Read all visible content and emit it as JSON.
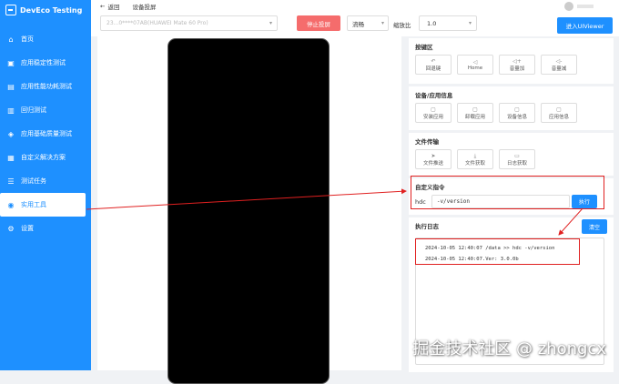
{
  "app": {
    "title": "DevEco Testing"
  },
  "sidebar": {
    "items": [
      {
        "label": "首页",
        "icon": "home-icon",
        "glyph": "⌂"
      },
      {
        "label": "应用稳定性测试",
        "icon": "stability-icon",
        "glyph": "▣"
      },
      {
        "label": "应用性能功耗测试",
        "icon": "performance-icon",
        "glyph": "▤"
      },
      {
        "label": "回归测试",
        "icon": "regression-icon",
        "glyph": "▥"
      },
      {
        "label": "应用基础质量测试",
        "icon": "quality-icon",
        "glyph": "◈"
      },
      {
        "label": "自定义解决方案",
        "icon": "solution-icon",
        "glyph": "▦"
      },
      {
        "label": "测试任务",
        "icon": "task-icon",
        "glyph": "☰"
      },
      {
        "label": "实用工具",
        "icon": "tools-icon",
        "glyph": "◉"
      },
      {
        "label": "设置",
        "icon": "settings-icon",
        "glyph": "⚙"
      }
    ]
  },
  "topbar": {
    "back_label": "返回",
    "breadcrumb": "设备投屏"
  },
  "controls": {
    "device": "23...0****07AB(HUAWEI Mate 60 Pro)",
    "stop_label": "停止投屏",
    "fluency": "流畅",
    "scale_label": "缩放比",
    "scale_value": "1.0",
    "uiviewer_label": "进入UIViewer"
  },
  "keys_card": {
    "title": "按键区",
    "buttons": [
      {
        "label": "回退键",
        "glyph": "↶"
      },
      {
        "label": "Home",
        "glyph": "◁"
      },
      {
        "label": "音量加",
        "glyph": "◁+"
      },
      {
        "label": "音量减",
        "glyph": "◁-"
      }
    ]
  },
  "device_card": {
    "title": "设备/应用信息",
    "buttons": [
      {
        "label": "安装应用",
        "glyph": "▢"
      },
      {
        "label": "卸载应用",
        "glyph": "▢"
      },
      {
        "label": "设备信息",
        "glyph": "▢"
      },
      {
        "label": "应用信息",
        "glyph": "▢"
      }
    ]
  },
  "file_card": {
    "title": "文件传输",
    "buttons": [
      {
        "label": "文件推送",
        "glyph": "➤"
      },
      {
        "label": "文件获取",
        "glyph": "⤓"
      },
      {
        "label": "日志获取",
        "glyph": "▭"
      }
    ]
  },
  "cmd_card": {
    "title": "自定义指令",
    "prefix": "hdc",
    "command": "-v/version",
    "exec_label": "执行"
  },
  "log_card": {
    "title": "执行日志",
    "clear_label": "清空",
    "lines": [
      "2024-10-05 12:40:07 /data >> hdc -v/version",
      "2024-10-05 12:40:07.Ver: 3.0.0b"
    ]
  },
  "watermark": "掘金技术社区 @ zhongcx",
  "colors": {
    "accent": "#1e90ff",
    "danger": "#f56c6c",
    "highlight": "#e02020"
  }
}
